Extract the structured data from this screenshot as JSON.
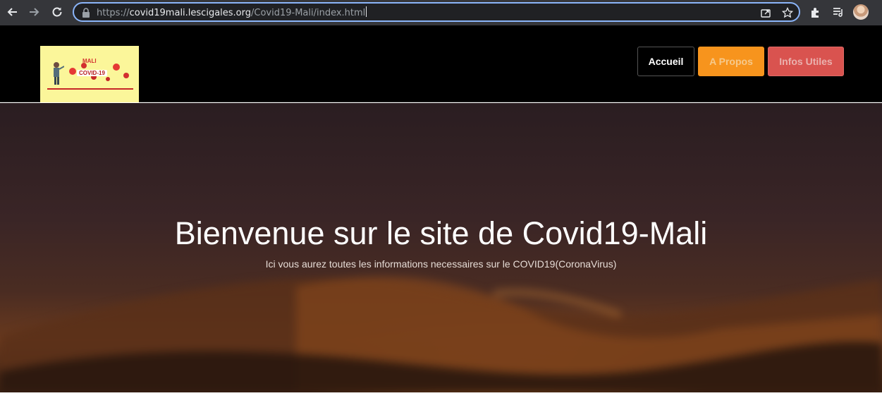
{
  "browser": {
    "url_scheme": "https://",
    "url_host": "covid19mali.lescigales.org",
    "url_path": "/Covid19-Mali/index.html",
    "icons": [
      "back-icon",
      "forward-icon",
      "reload-icon",
      "lock-icon",
      "share-icon",
      "star-icon",
      "extensions-icon",
      "reading-list-icon",
      "profile-avatar"
    ]
  },
  "header": {
    "logo": {
      "word": "MALI",
      "sub": "COVID-19"
    },
    "nav": [
      {
        "label": "Accueil"
      },
      {
        "label": "A Propos"
      },
      {
        "label": "Infos Utiles"
      }
    ]
  },
  "hero": {
    "title": "Bienvenue sur le site de Covid19-Mali",
    "subtitle": "Ici vous aurez toutes les informations necessaires sur le COVID19(CoronaVirus)"
  },
  "colors": {
    "accent_orange": "#f7941d",
    "accent_red": "#d9534f",
    "omnibox_focus": "#8ab4f8"
  }
}
